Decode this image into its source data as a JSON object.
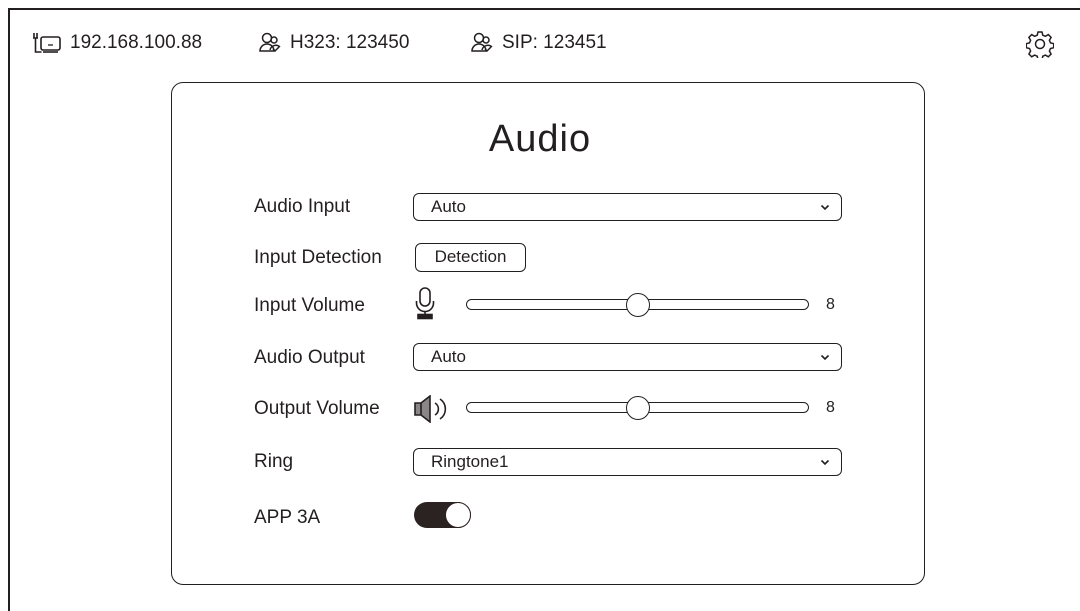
{
  "status_bar": {
    "ip_address": "192.168.100.88",
    "h323": "H323: 123450",
    "sip": "SIP: 123451",
    "icons": [
      "network-icon",
      "h323-contact-icon",
      "sip-contact-icon",
      "gear-icon"
    ]
  },
  "panel": {
    "title": "Audio",
    "audio_input": {
      "label": "Audio Input",
      "value": "Auto"
    },
    "input_detection": {
      "label": "Input Detection",
      "button": "Detection"
    },
    "input_volume": {
      "label": "Input Volume",
      "value": "8",
      "level": 0.5
    },
    "audio_output": {
      "label": "Audio Output",
      "value": "Auto"
    },
    "output_volume": {
      "label": "Output Volume",
      "value": "8",
      "level": 0.5
    },
    "ring": {
      "label": "Ring",
      "value": "Ringtone1"
    },
    "app3a": {
      "label": "APP 3A",
      "enabled": true
    }
  },
  "colors": {
    "ink": "#231f20",
    "toggle_on": "#2b2321",
    "background": "#ffffff"
  }
}
